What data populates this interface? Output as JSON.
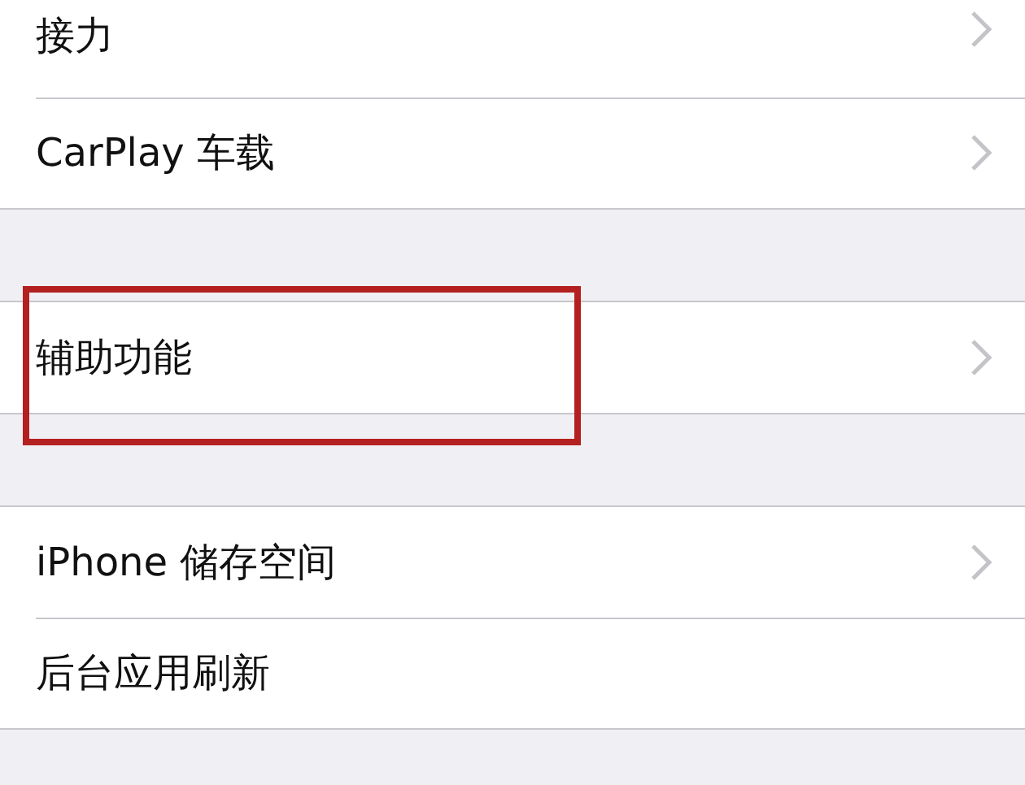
{
  "groups": [
    {
      "items": [
        {
          "label": "接力",
          "chevron": true,
          "highlighted": false
        },
        {
          "label": "CarPlay 车载",
          "chevron": true,
          "highlighted": false
        }
      ]
    },
    {
      "items": [
        {
          "label": "辅助功能",
          "chevron": true,
          "highlighted": true
        }
      ]
    },
    {
      "items": [
        {
          "label": "iPhone 储存空间",
          "chevron": true,
          "highlighted": false
        },
        {
          "label": "后台应用刷新",
          "chevron": false,
          "highlighted": false
        }
      ]
    }
  ]
}
